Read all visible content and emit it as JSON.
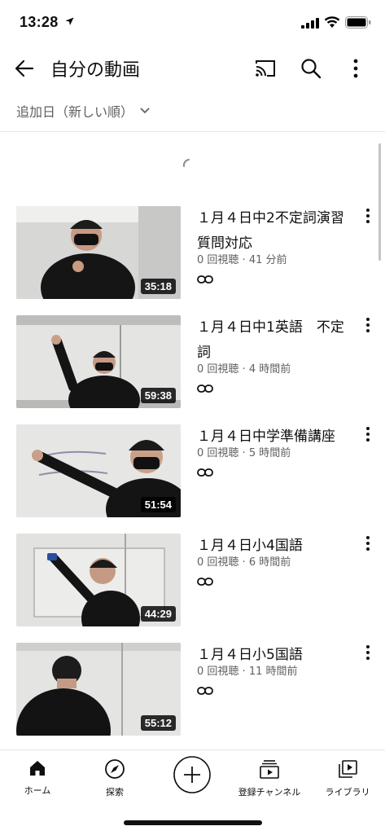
{
  "status": {
    "time": "13:28"
  },
  "header": {
    "title": "自分の動画"
  },
  "sort": {
    "label": "追加日（新しい順）"
  },
  "videos": [
    {
      "title": "１月４日中2不定詞演習質問対応",
      "views": "0 回視聴",
      "age": "41 分前",
      "duration": "35:18"
    },
    {
      "title": "１月４日中1英語　不定詞",
      "views": "0 回視聴",
      "age": "4 時間前",
      "duration": "59:38"
    },
    {
      "title": "１月４日中学準備講座",
      "views": "0 回視聴",
      "age": "5 時間前",
      "duration": "51:54"
    },
    {
      "title": "１月４日小4国語",
      "views": "0 回視聴",
      "age": "6 時間前",
      "duration": "44:29"
    },
    {
      "title": "１月４日小5国語",
      "views": "0 回視聴",
      "age": "11 時間前",
      "duration": "55:12"
    }
  ],
  "meta_separator": " · ",
  "nav": {
    "home": "ホーム",
    "explore": "探索",
    "subscriptions": "登録チャンネル",
    "library": "ライブラリ"
  },
  "icons": {
    "back": "arrow-left-icon",
    "cast": "cast-icon",
    "search": "search-icon",
    "more": "more-vert-icon",
    "link": "link-icon",
    "home": "home-icon",
    "explore": "compass-icon",
    "create": "plus-circle-icon",
    "subscriptions": "subscriptions-icon",
    "library": "library-icon"
  },
  "colors": {
    "text": "#0f0f0f",
    "secondary": "#606060",
    "divider": "#e5e5e5"
  }
}
